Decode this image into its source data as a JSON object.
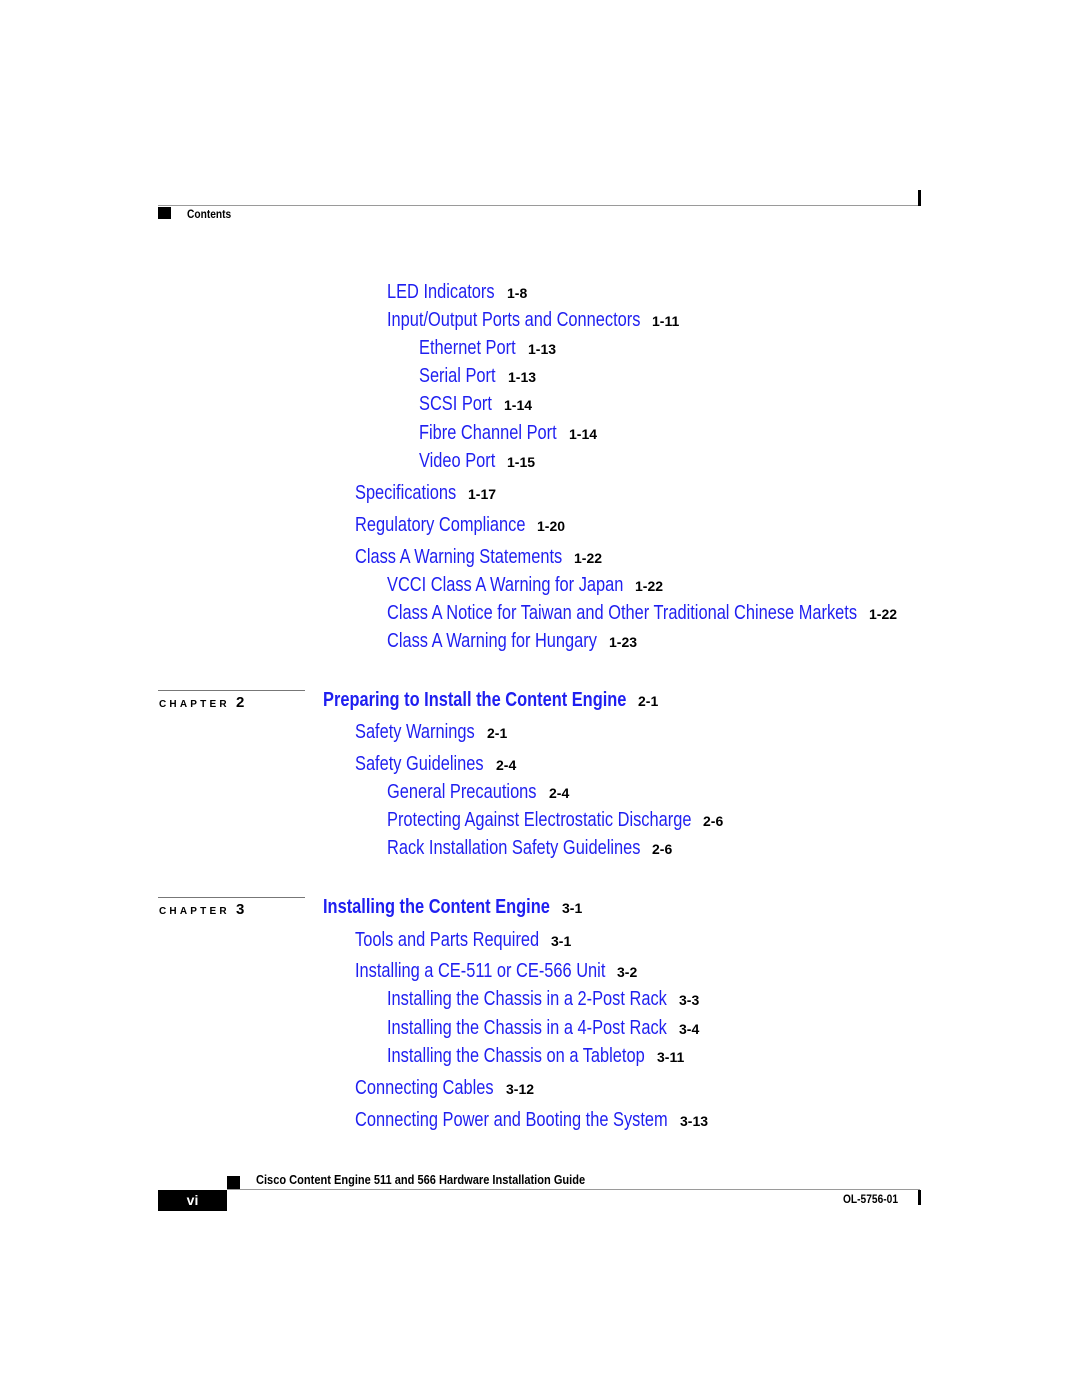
{
  "header": {
    "section_label": "Contents"
  },
  "toc": {
    "entries": [
      {
        "title": "LED Indicators",
        "page": "1-8",
        "level": 2
      },
      {
        "title": "Input/Output Ports and Connectors",
        "page": "1-11",
        "level": 2
      },
      {
        "title": "Ethernet Port",
        "page": "1-13",
        "level": 3
      },
      {
        "title": "Serial Port",
        "page": "1-13",
        "level": 3
      },
      {
        "title": "SCSI Port",
        "page": "1-14",
        "level": 3
      },
      {
        "title": "Fibre Channel Port",
        "page": "1-14",
        "level": 3
      },
      {
        "title": "Video Port",
        "page": "1-15",
        "level": 3
      },
      {
        "title": "Specifications",
        "page": "1-17",
        "level": 1
      },
      {
        "title": "Regulatory Compliance",
        "page": "1-20",
        "level": 1
      },
      {
        "title": "Class A Warning Statements",
        "page": "1-22",
        "level": 1
      },
      {
        "title": "VCCI Class A Warning for Japan",
        "page": "1-22",
        "level": 2
      },
      {
        "title": "Class A Notice for Taiwan and Other Traditional Chinese Markets",
        "page": "1-22",
        "level": 2
      },
      {
        "title": "Class A Warning for Hungary",
        "page": "1-23",
        "level": 2
      }
    ],
    "chapters": [
      {
        "label": "CHAPTER",
        "number": "2",
        "title": "Preparing to Install the Content Engine",
        "page": "2-1",
        "entries": [
          {
            "title": "Safety Warnings",
            "page": "2-1",
            "level": 1
          },
          {
            "title": "Safety Guidelines",
            "page": "2-4",
            "level": 1
          },
          {
            "title": "General Precautions",
            "page": "2-4",
            "level": 2
          },
          {
            "title": "Protecting Against Electrostatic Discharge",
            "page": "2-6",
            "level": 2
          },
          {
            "title": "Rack Installation Safety Guidelines",
            "page": "2-6",
            "level": 2
          }
        ]
      },
      {
        "label": "CHAPTER",
        "number": "3",
        "title": "Installing the Content Engine",
        "page": "3-1",
        "entries": [
          {
            "title": "Tools and Parts Required",
            "page": "3-1",
            "level": 1
          },
          {
            "title": "Installing a CE-511 or CE-566 Unit",
            "page": "3-2",
            "level": 1
          },
          {
            "title": "Installing the Chassis in a 2-Post Rack",
            "page": "3-3",
            "level": 2
          },
          {
            "title": "Installing the Chassis in a 4-Post Rack",
            "page": "3-4",
            "level": 2
          },
          {
            "title": "Installing the Chassis on a Tabletop",
            "page": "3-11",
            "level": 2
          },
          {
            "title": "Connecting Cables",
            "page": "3-12",
            "level": 1
          },
          {
            "title": "Connecting Power and Booting the System",
            "page": "3-13",
            "level": 1
          }
        ]
      }
    ]
  },
  "footer": {
    "book_title": "Cisco Content Engine 511 and 566 Hardware Installation Guide",
    "page_number": "vi",
    "doc_number": "OL-5756-01"
  }
}
